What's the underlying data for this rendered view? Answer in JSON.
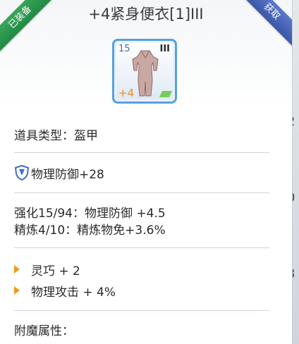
{
  "item": {
    "title": "+4紧身便衣[1]III",
    "equipped_badge": "已装备",
    "obtain_badge": "获取",
    "level": "15",
    "slots": "III",
    "refine": "+4"
  },
  "details": {
    "type_line": "道具类型：盔甲",
    "defense_line": "物理防御+28",
    "enhance_line": "强化15/94：物理防御 +4.5",
    "refine_line": "精炼4/10：精炼物免+3.6%",
    "bonus_items": [
      "灵巧 + 2",
      "物理攻击 + 4%"
    ],
    "enchant_label": "附魔属性："
  },
  "side_peek": [
    "2",
    "0",
    "3"
  ],
  "colors": {
    "equipped_ribbon": "#1f8a43",
    "obtain_ribbon": "#3b56a8",
    "item_border": "#5a9fe0",
    "bullet": "#f39a1e",
    "shield_icon": "#3f6fd1"
  }
}
